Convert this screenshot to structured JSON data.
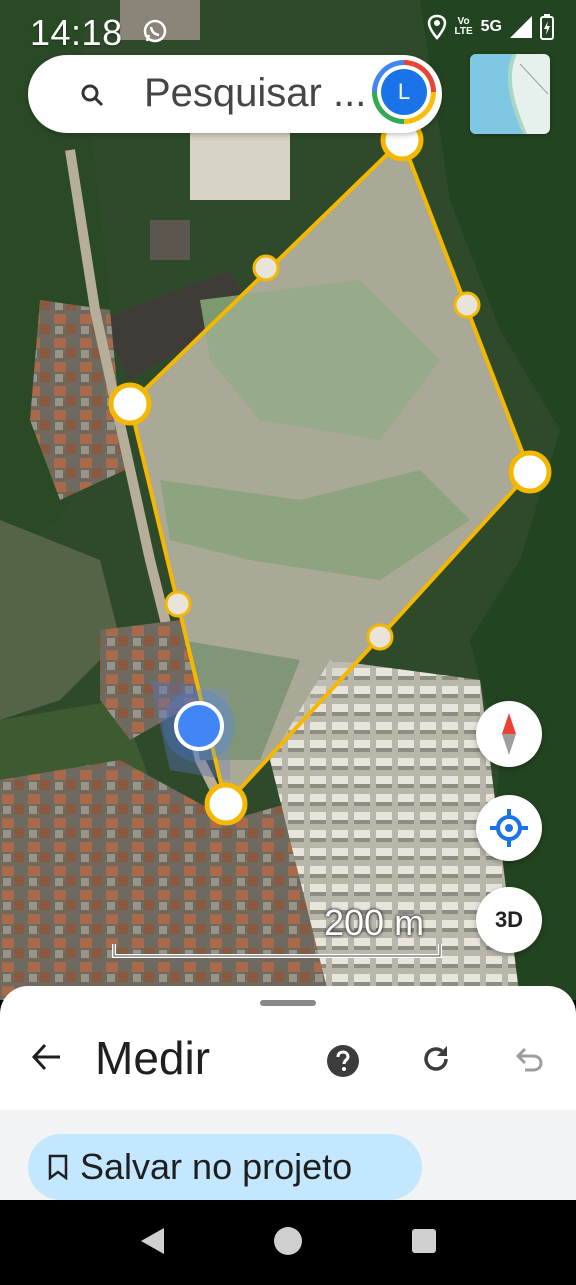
{
  "status_bar": {
    "time": "14:18",
    "net_top": "Vo",
    "net_bottom": "LTE",
    "network": "5G",
    "icons": [
      "whatsapp-icon",
      "location-icon",
      "signal-icon",
      "battery-icon"
    ]
  },
  "search": {
    "placeholder": "Pesquisar ...",
    "avatar_letter": "L"
  },
  "map": {
    "scale_label": "200 m",
    "three_d_label": "3D",
    "polygon_color": "#f5b800",
    "my_location_color": "#4285f4"
  },
  "measure_panel": {
    "title": "Medir",
    "save_button": "Salvar no projeto",
    "accent": "#c2e7ff",
    "icons": [
      "back-arrow-icon",
      "help-icon",
      "refresh-icon",
      "undo-icon",
      "bookmark-icon"
    ]
  }
}
